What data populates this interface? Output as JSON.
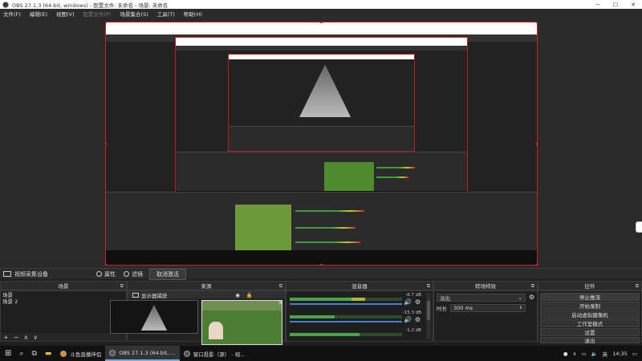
{
  "window": {
    "title": "OBS 27.1.3 (64-bit, windows) - 配置文件: 未命名 - 场景: 未命名"
  },
  "menu": {
    "items": [
      "文件(F)",
      "编辑(E)",
      "视图(V)",
      "配置文件(P)",
      "场景集合(S)",
      "工具(T)",
      "帮助(H)"
    ],
    "disabled_index": 3
  },
  "source_bar": {
    "source_name": "视频采集设备",
    "properties": "属性",
    "filters": "滤镜",
    "stop_preview": "取消激活"
  },
  "docks": {
    "scenes": "场景",
    "sources": "来源",
    "mixer": "混音器",
    "transitions": "转场特效",
    "controls": "控件"
  },
  "scenes": {
    "items": [
      "场景",
      "场景 2"
    ],
    "selected": 0
  },
  "sources": {
    "item": "显示器捕获"
  },
  "mixer": {
    "rows": [
      {
        "db": "-6.7 dB"
      },
      {
        "db": "-15.3 dB"
      },
      {
        "db": "-1.2 dB"
      }
    ]
  },
  "transitions": {
    "type": "淡出",
    "duration_label": "时长",
    "duration": "300 ms"
  },
  "controls": {
    "buttons": [
      "停止推流",
      "开始录制",
      "启动虚拟摄像机",
      "工作室模式",
      "设置",
      "退出"
    ]
  },
  "taskbar": {
    "items": [
      {
        "label": "斗鱼直播伴侣",
        "active": false
      },
      {
        "label": "OBS 27.1.3 (64-bit, ...",
        "active": true
      },
      {
        "label": "窗口投影（源） - 视...",
        "active": false
      }
    ],
    "time": "14:35",
    "ime": "英"
  },
  "colors": {
    "accent_red": "#d02020",
    "meter_green": "#49a549",
    "meter_yellow": "#b5b52c",
    "slider_blue": "#4a7bd8"
  }
}
